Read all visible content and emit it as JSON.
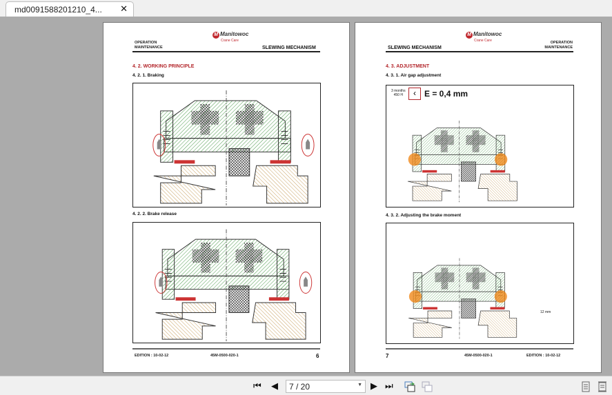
{
  "tab": {
    "title": "md0091588201210_4...",
    "close": "✕"
  },
  "pages": [
    {
      "header_left": [
        "OPERATION",
        "MAINTENANCE"
      ],
      "header_right": "SLEWING MECHANISM",
      "logo": "Manitowoc",
      "logo_sub": "Crane Care",
      "section": "4. 2. WORKING PRINCIPLE",
      "sub1": "4. 2. 1. Braking",
      "sub2": "4. 2. 2. Brake release",
      "footer_edition": "EDITION :  10-02-12",
      "footer_code": "45M-0500-020-1",
      "page_number": "6"
    },
    {
      "header_left": "SLEWING MECHANISM",
      "header_right": [
        "OPERATION",
        "MAINTENANCE"
      ],
      "logo": "Manitowoc",
      "logo_sub": "Crane Care",
      "section": "4. 3. ADJUSTMENT",
      "sub1": "4. 3. 1. Air gap adjustment",
      "sub2": "4. 3. 2. Adjusting the brake moment",
      "interval": [
        "3 months",
        "450 H"
      ],
      "gap_formula": "E = 0,4 mm",
      "dim_label": "12 mm",
      "footer_edition": "EDITION :  10-02-12",
      "footer_code": "45M-0500-020-1",
      "page_number": "7"
    }
  ],
  "toolbar": {
    "page_value": "7 / 20",
    "first": "⏮",
    "prev": "◀",
    "next": "▶",
    "last": "⏭"
  },
  "colors": {
    "accent": "#b3262b",
    "hatch_green": "#4a9a4a",
    "hatch_tan": "#c8a060",
    "orange": "#f08a1c"
  }
}
